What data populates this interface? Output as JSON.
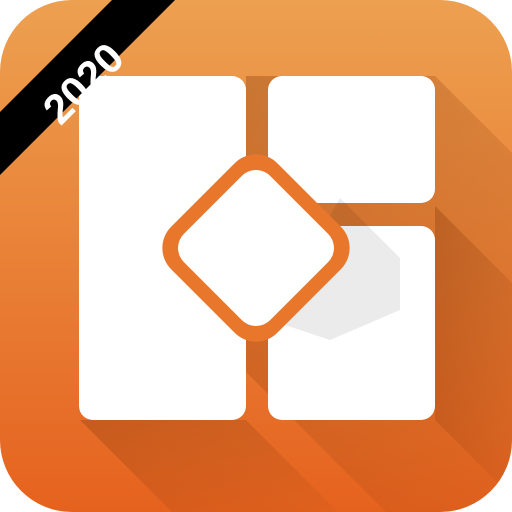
{
  "badge": {
    "year_label": "2020"
  },
  "colors": {
    "background_top": "#EDA050",
    "background_bottom": "#E5621E",
    "tile": "#FFFFFF",
    "diamond_ring": "#E8772C",
    "ribbon": "#000000",
    "ribbon_text": "#FFFFFF"
  },
  "icons": {
    "app_icon": "layout-grid-with-diamond-icon"
  }
}
